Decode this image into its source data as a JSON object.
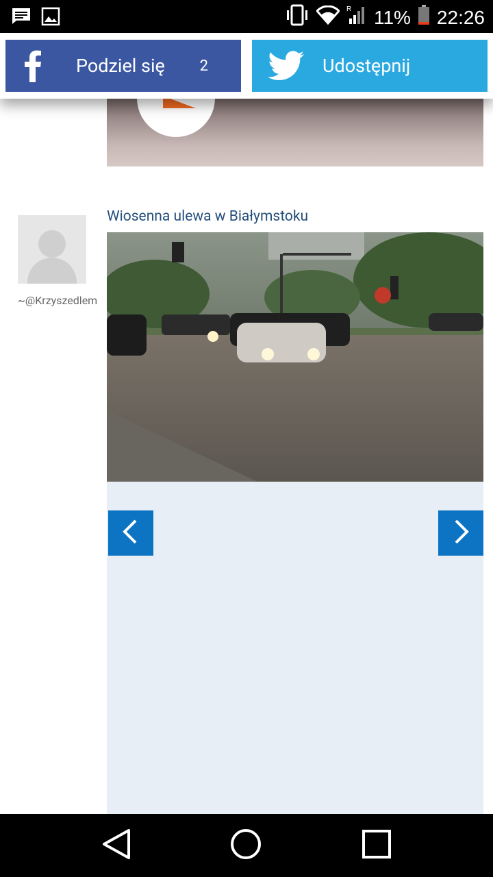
{
  "status_bar": {
    "battery": "11%",
    "time": "22:26",
    "icons": [
      "message-icon",
      "image-icon",
      "vibrate-icon",
      "wifi-icon",
      "signal-roaming-icon",
      "battery-low-icon"
    ]
  },
  "share_bar": {
    "facebook": {
      "label": "Podziel się",
      "count": "2",
      "color": "#3b57a1"
    },
    "twitter": {
      "label": "Udostępnij",
      "color": "#2aa9e0"
    }
  },
  "post": {
    "author_handle": "~@Krzyszedlem",
    "gallery_title": "Wiosenna ulewa w Białymstoku"
  },
  "gallery": {
    "prev_icon": "chevron-left-icon",
    "next_icon": "chevron-right-icon",
    "accent": "#0d74c4",
    "panel_bg": "#e8eef6"
  },
  "nav_bar": {
    "items": [
      "back-icon",
      "home-icon",
      "recents-icon"
    ]
  }
}
